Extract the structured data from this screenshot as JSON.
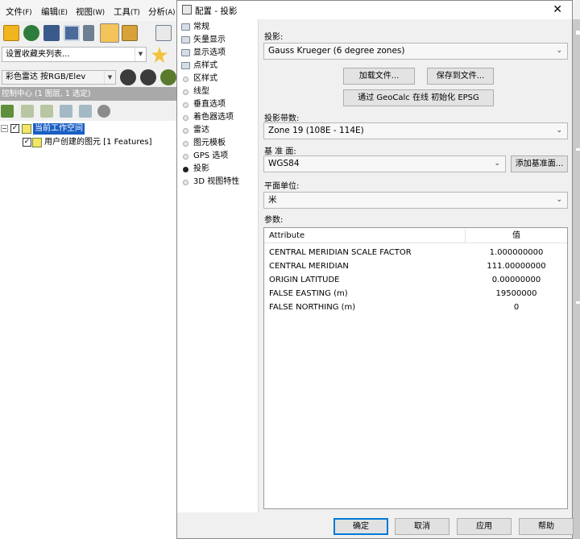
{
  "bg": {
    "menu": [
      {
        "label": "文件",
        "acc": "(F)"
      },
      {
        "label": "编辑",
        "acc": "(E)"
      },
      {
        "label": "视图",
        "acc": "(W)"
      },
      {
        "label": "工具",
        "acc": "(T)"
      },
      {
        "label": "分析",
        "acc": "(A)"
      }
    ],
    "favorites_combo": "设置收藏夹列表...",
    "shader_combo": "彩色雷达 按RGB/Elev",
    "control_center_header": "控制中心 (1 图层, 1 选定)",
    "tree": {
      "workspace": "当前工作空间",
      "layer": "用户创建的图元 [1 Features]"
    }
  },
  "dialog": {
    "title": "配置 - 投影",
    "close_glyph": "✕",
    "nav": [
      {
        "label": "常规",
        "icon": "folder-icon"
      },
      {
        "label": "矢量显示",
        "icon": "folder-icon"
      },
      {
        "label": "显示选项",
        "icon": "folder-icon"
      },
      {
        "label": "点样式",
        "icon": "folder-icon"
      },
      {
        "label": "区样式",
        "icon": "dot-icon"
      },
      {
        "label": "线型",
        "icon": "dot-icon"
      },
      {
        "label": "垂直选项",
        "icon": "dot-icon"
      },
      {
        "label": "着色器选项",
        "icon": "dot-icon"
      },
      {
        "label": "雷达",
        "icon": "dot-icon"
      },
      {
        "label": "图元模板",
        "icon": "dot-icon"
      },
      {
        "label": "GPS 选项",
        "icon": "dot-icon"
      },
      {
        "label": "投影",
        "icon": "dot-icon-selected"
      },
      {
        "label": "3D 视图特性",
        "icon": "dot-icon"
      }
    ],
    "projection_label": "投影:",
    "projection_value": "Gauss Krueger (6 degree zones)",
    "load_file_button": "加载文件...",
    "save_file_button": "保存到文件...",
    "geocalc_button": "通过 GeoCalc 在线 初始化 EPSG",
    "zone_label": "投影带数:",
    "zone_value": "Zone 19 (108E - 114E)",
    "datum_label": "基 准 面:",
    "datum_value": "WGS84",
    "add_datum_button": "添加基准面...",
    "units_label": "平面单位:",
    "units_value": "米",
    "params_label": "参数:",
    "params_table": {
      "headers": [
        "Attribute",
        "值"
      ],
      "rows": [
        [
          "CENTRAL MERIDIAN SCALE FACTOR",
          "1.000000000"
        ],
        [
          "CENTRAL MERIDIAN",
          "111.00000000"
        ],
        [
          "ORIGIN LATITUDE",
          "0.00000000"
        ],
        [
          "FALSE EASTING (m)",
          "19500000"
        ],
        [
          "FALSE NORTHING (m)",
          "0"
        ]
      ]
    },
    "footer": {
      "ok": "确定",
      "cancel": "取消",
      "apply": "应用",
      "help": "帮助"
    }
  }
}
